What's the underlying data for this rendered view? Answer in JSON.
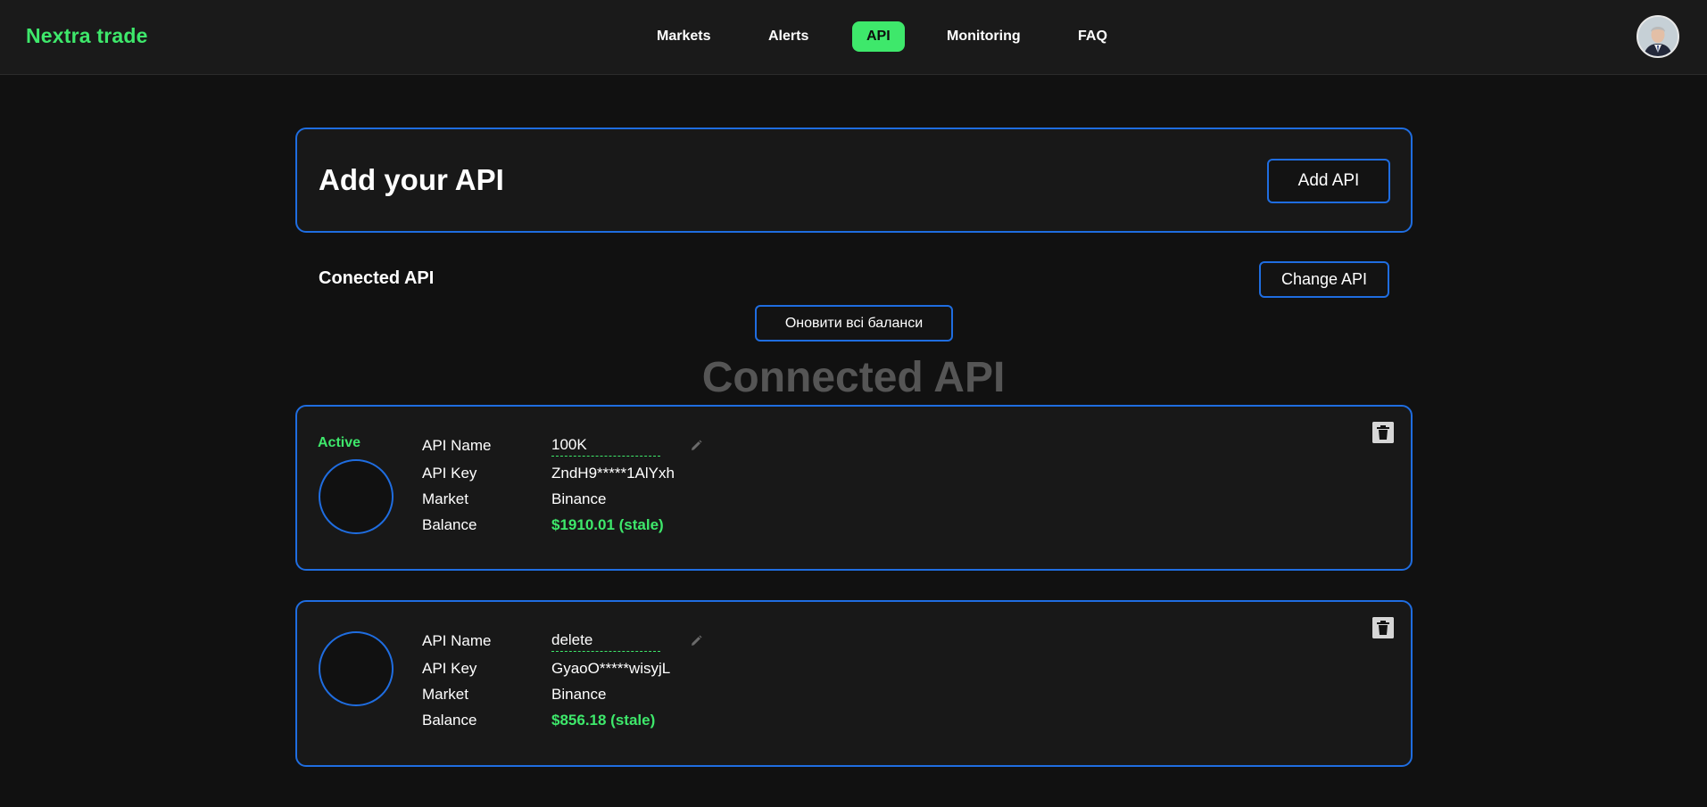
{
  "brand": "Nextra trade",
  "nav": [
    {
      "label": "Markets",
      "active": false
    },
    {
      "label": "Alerts",
      "active": false
    },
    {
      "label": "API",
      "active": true
    },
    {
      "label": "Monitoring",
      "active": false
    },
    {
      "label": "FAQ",
      "active": false
    }
  ],
  "add_card": {
    "title": "Add your API",
    "button": "Add API"
  },
  "connected": {
    "section_title": "Conected API",
    "change_button": "Change API",
    "refresh_button": "Оновити всі баланси",
    "heading": "Connected API"
  },
  "labels": {
    "name": "API Name",
    "key": "API Key",
    "market": "Market",
    "balance": "Balance"
  },
  "apis": [
    {
      "status": "Active",
      "name": "100K",
      "key": "ZndH9*****1AlYxh",
      "market": "Binance",
      "balance": "$1910.01 (stale)"
    },
    {
      "status": "",
      "name": "delete",
      "key": "GyaoO*****wisyjL",
      "market": "Binance",
      "balance": "$856.18 (stale)"
    }
  ],
  "colors": {
    "accent": "#3ee86b",
    "border": "#1f6de0",
    "background": "#111111"
  },
  "icons": {
    "edit": "pencil-icon",
    "delete": "trash-icon",
    "avatar": "user-avatar"
  }
}
